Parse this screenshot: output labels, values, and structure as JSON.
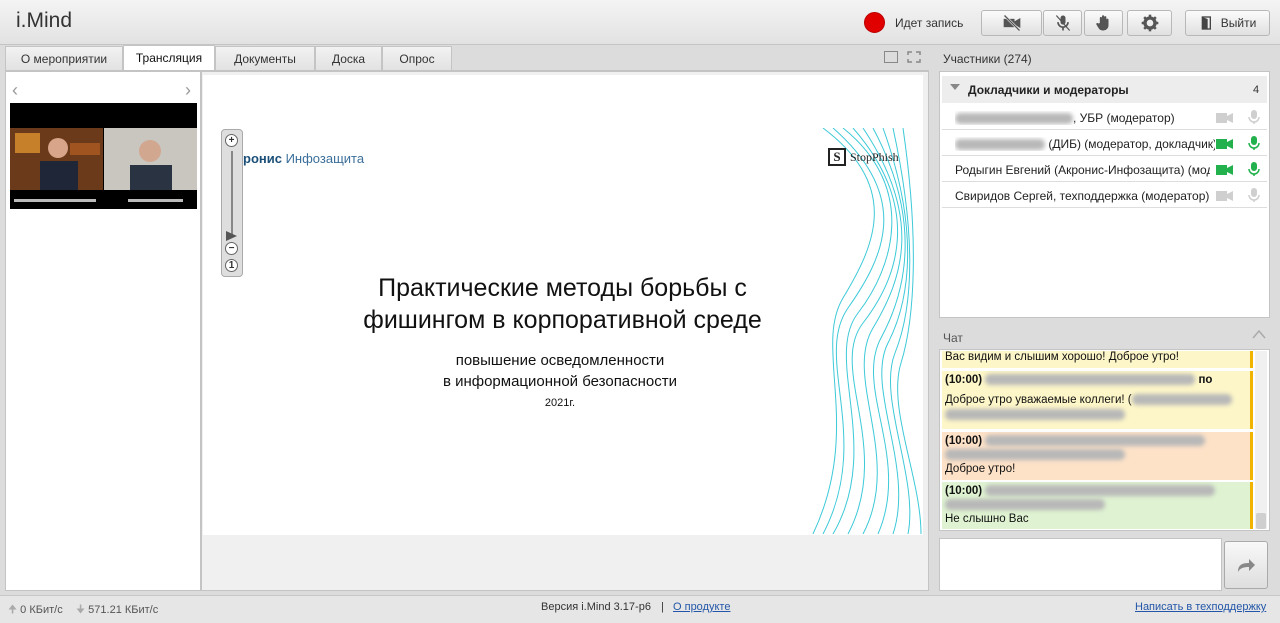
{
  "app": {
    "title": "i.Mind"
  },
  "header": {
    "recording_label": "Идет запись",
    "exit_label": "Выйти"
  },
  "tabs": [
    {
      "label": "О мероприятии",
      "active": false
    },
    {
      "label": "Трансляция",
      "active": true
    },
    {
      "label": "Документы",
      "active": false
    },
    {
      "label": "Доска",
      "active": false
    },
    {
      "label": "Опрос",
      "active": false
    }
  ],
  "slide": {
    "logo_bold": "ронис",
    "logo_light": " Инфозащита",
    "brand": "StopPhish",
    "brand_mark": "S",
    "title_line1": "Практические методы борьбы с",
    "title_line2": "фишингом в корпоративной среде",
    "subtitle_line1": "повышение осведомленности",
    "subtitle_line2": "в информационной безопасности",
    "year": "2021г."
  },
  "participants": {
    "title": "Участники (274)",
    "group_label": "Докладчики и модераторы",
    "group_count": "4",
    "rows": [
      {
        "name": ", УБР (модератор)",
        "camera_on": false,
        "mic_on": false
      },
      {
        "name": " (ДИБ) (модератор, докладчик)",
        "camera_on": true,
        "mic_on": true
      },
      {
        "name": "Родыгин Евгений (Акронис-Инфозащита) (мод...",
        "camera_on": true,
        "mic_on": true
      },
      {
        "name": "Свиридов Сергей, техподдержка (модератор)",
        "camera_on": false,
        "mic_on": false
      }
    ]
  },
  "chat": {
    "title": "Чат",
    "messages": [
      {
        "time": "",
        "suffix": "",
        "text": "Вас видим и слышим хорошо! Доброе утро!",
        "color": "#fdf6c8"
      },
      {
        "time": "(10:00)",
        "suffix": "по",
        "text": "Доброе утро уважаемые коллеги! (",
        "color": "#fdf6c8"
      },
      {
        "time": "(10:00)",
        "suffix": "",
        "text": "Доброе утро!",
        "color": "#fde2c8"
      },
      {
        "time": "(10:00)",
        "suffix": "",
        "text": "Не слышно Вас",
        "color": "#dff3d2"
      }
    ]
  },
  "footer": {
    "upload": "0 КБит/с",
    "download": "571.21 КБит/с",
    "version": "Версия i.Mind 3.17-р6",
    "separator": "|",
    "about_link": "О продукте",
    "support_link": "Написать в техподдержку"
  },
  "colors": {
    "accent_green": "#22b14c",
    "recording_red": "#e00000",
    "link_blue": "#2356a8"
  }
}
